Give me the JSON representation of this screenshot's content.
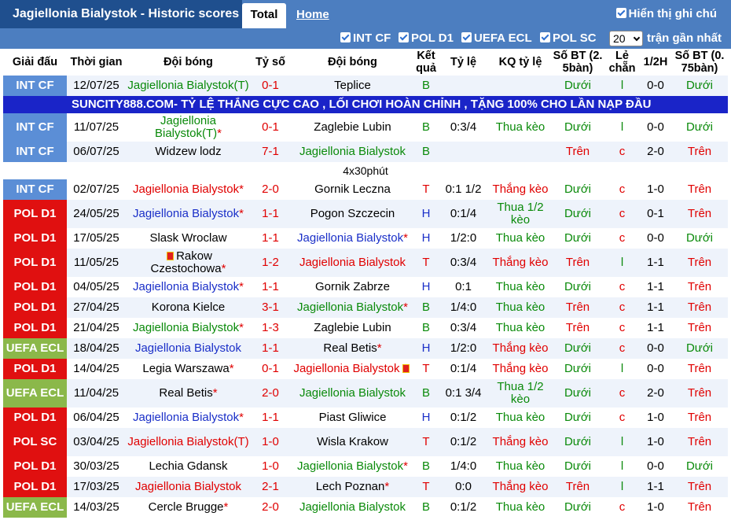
{
  "header": {
    "title": "Jagiellonia Bialystok - Historic scores",
    "tab_total": "Total",
    "tab_home": "Home",
    "vn_label": "Hiển thị ghi chú"
  },
  "filters": {
    "items": [
      "INT CF",
      "POL D1",
      "UEFA ECL",
      "POL SC"
    ],
    "count_value": "20",
    "recent_label": "trận gần nhất"
  },
  "columns": [
    "Giải đấu",
    "Thời gian",
    "Đội bóng",
    "Tỷ số",
    "Đội bóng",
    "Kết quả",
    "Tỷ lệ",
    "KQ tỷ lệ",
    "Số BT (2. 5bàn)",
    "Lẻ chẵn",
    "1/2H",
    "Số BT (0. 75bàn)"
  ],
  "ad_text": "SUNCITY888.COM- TỶ LỆ THẮNG CỰC CAO , LỐI CHƠI HOÀN CHỈNH , TẶNG 100% CHO LẦN NẠP ĐẦU",
  "note_text": "4x30phút",
  "colors": {
    "int_cf": "#5b8ed6",
    "pol": "#e01010",
    "ecl": "#8bb84a",
    "ad": "#1a24c8",
    "bar": "#4c7ec0"
  },
  "rows": [
    {
      "comp": "INT CF",
      "date": "12/07/25",
      "home": "Jagiellonia Bialystok(T)",
      "home_color": "green",
      "home_star": "",
      "score": "0-1",
      "away": "Teplice",
      "away_color": "black",
      "away_star": "",
      "res": "B",
      "odds": "",
      "oddres": "",
      "ou": "Dưới",
      "oe": "l",
      "ht": "0-0",
      "ou2": "Dưới"
    },
    {
      "comp": "INT CF",
      "date": "11/07/25",
      "home": "Jagiellonia Bialystok(T)",
      "home_color": "green",
      "home_star": "*",
      "score": "0-1",
      "away": "Zaglebie Lubin",
      "away_color": "black",
      "away_star": "",
      "res": "B",
      "odds": "0:3/4",
      "oddres": "Thua kèo",
      "ou": "Dưới",
      "oe": "l",
      "ht": "0-0",
      "ou2": "Dưới"
    },
    {
      "comp": "INT CF",
      "date": "06/07/25",
      "home": "Widzew lodz",
      "home_color": "black",
      "home_star": "",
      "score": "7-1",
      "away": "Jagiellonia Bialystok",
      "away_color": "green",
      "away_star": "",
      "res": "B",
      "odds": "",
      "oddres": "",
      "ou": "Trên",
      "oe": "c",
      "ht": "2-0",
      "ou2": "Trên"
    },
    {
      "comp": "INT CF",
      "date": "02/07/25",
      "home": "Jagiellonia Bialystok",
      "home_color": "red",
      "home_star": "*",
      "score": "2-0",
      "away": "Gornik Leczna",
      "away_color": "black",
      "away_star": "",
      "res": "T",
      "odds": "0:1 1/2",
      "oddres": "Thắng kèo",
      "ou": "Dưới",
      "oe": "c",
      "ht": "1-0",
      "ou2": "Trên"
    },
    {
      "comp": "POL D1",
      "date": "24/05/25",
      "home": "Jagiellonia Bialystok",
      "home_color": "blue",
      "home_star": "*",
      "score": "1-1",
      "away": "Pogon Szczecin",
      "away_color": "black",
      "away_star": "",
      "res": "H",
      "odds": "0:1/4",
      "oddres": "Thua 1/2 kèo",
      "ou": "Dưới",
      "oe": "c",
      "ht": "0-1",
      "ou2": "Trên"
    },
    {
      "comp": "POL D1",
      "date": "17/05/25",
      "home": "Slask Wroclaw",
      "home_color": "black",
      "home_star": "",
      "score": "1-1",
      "away": "Jagiellonia Bialystok",
      "away_color": "blue",
      "away_star": "*",
      "res": "H",
      "odds": "1/2:0",
      "oddres": "Thua kèo",
      "ou": "Dưới",
      "oe": "c",
      "ht": "0-0",
      "ou2": "Dưới"
    },
    {
      "comp": "POL D1",
      "date": "11/05/25",
      "home": "Rakow Czestochowa",
      "home_color": "black",
      "home_star": "*",
      "score": "1-2",
      "away": "Jagiellonia Bialystok",
      "away_color": "red",
      "away_star": "",
      "res": "T",
      "odds": "0:3/4",
      "oddres": "Thắng kèo",
      "ou": "Trên",
      "oe": "l",
      "ht": "1-1",
      "ou2": "Trên"
    },
    {
      "comp": "POL D1",
      "date": "04/05/25",
      "home": "Jagiellonia Bialystok",
      "home_color": "blue",
      "home_star": "*",
      "score": "1-1",
      "away": "Gornik Zabrze",
      "away_color": "black",
      "away_star": "",
      "res": "H",
      "odds": "0:1",
      "oddres": "Thua kèo",
      "ou": "Dưới",
      "oe": "c",
      "ht": "1-1",
      "ou2": "Trên"
    },
    {
      "comp": "POL D1",
      "date": "27/04/25",
      "home": "Korona Kielce",
      "home_color": "black",
      "home_star": "",
      "score": "3-1",
      "away": "Jagiellonia Bialystok",
      "away_color": "green",
      "away_star": "*",
      "res": "B",
      "odds": "1/4:0",
      "oddres": "Thua kèo",
      "ou": "Trên",
      "oe": "c",
      "ht": "1-1",
      "ou2": "Trên"
    },
    {
      "comp": "POL D1",
      "date": "21/04/25",
      "home": "Jagiellonia Bialystok",
      "home_color": "green",
      "home_star": "*",
      "score": "1-3",
      "away": "Zaglebie Lubin",
      "away_color": "black",
      "away_star": "",
      "res": "B",
      "odds": "0:3/4",
      "oddres": "Thua kèo",
      "ou": "Trên",
      "oe": "c",
      "ht": "1-1",
      "ou2": "Trên"
    },
    {
      "comp": "UEFA ECL",
      "date": "18/04/25",
      "home": "Jagiellonia Bialystok",
      "home_color": "blue",
      "home_star": "",
      "score": "1-1",
      "away": "Real Betis",
      "away_color": "black",
      "away_star": "*",
      "res": "H",
      "odds": "1/2:0",
      "oddres": "Thắng kèo",
      "ou": "Dưới",
      "oe": "c",
      "ht": "0-0",
      "ou2": "Dưới"
    },
    {
      "comp": "POL D1",
      "date": "14/04/25",
      "home": "Legia Warszawa",
      "home_color": "black",
      "home_star": "*",
      "score": "0-1",
      "away": "Jagiellonia Bialystok",
      "away_color": "red",
      "away_star": "",
      "res": "T",
      "odds": "0:1/4",
      "oddres": "Thắng kèo",
      "ou": "Dưới",
      "oe": "l",
      "ht": "0-0",
      "ou2": "Trên"
    },
    {
      "comp": "UEFA ECL",
      "date": "11/04/25",
      "home": "Real Betis",
      "home_color": "black",
      "home_star": "*",
      "score": "2-0",
      "away": "Jagiellonia Bialystok",
      "away_color": "green",
      "away_star": "",
      "res": "B",
      "odds": "0:1 3/4",
      "oddres": "Thua 1/2 kèo",
      "ou": "Dưới",
      "oe": "c",
      "ht": "2-0",
      "ou2": "Trên"
    },
    {
      "comp": "POL D1",
      "date": "06/04/25",
      "home": "Jagiellonia Bialystok",
      "home_color": "blue",
      "home_star": "*",
      "score": "1-1",
      "away": "Piast Gliwice",
      "away_color": "black",
      "away_star": "",
      "res": "H",
      "odds": "0:1/2",
      "oddres": "Thua kèo",
      "ou": "Dưới",
      "oe": "c",
      "ht": "1-0",
      "ou2": "Trên"
    },
    {
      "comp": "POL SC",
      "date": "03/04/25",
      "home": "Jagiellonia Bialystok(T)",
      "home_color": "red",
      "home_star": "",
      "score": "1-0",
      "away": "Wisla Krakow",
      "away_color": "black",
      "away_star": "",
      "res": "T",
      "odds": "0:1/2",
      "oddres": "Thắng kèo",
      "ou": "Dưới",
      "oe": "l",
      "ht": "1-0",
      "ou2": "Trên"
    },
    {
      "comp": "POL D1",
      "date": "30/03/25",
      "home": "Lechia Gdansk",
      "home_color": "black",
      "home_star": "",
      "score": "1-0",
      "away": "Jagiellonia Bialystok",
      "away_color": "green",
      "away_star": "*",
      "res": "B",
      "odds": "1/4:0",
      "oddres": "Thua kèo",
      "ou": "Dưới",
      "oe": "l",
      "ht": "0-0",
      "ou2": "Dưới"
    },
    {
      "comp": "POL D1",
      "date": "17/03/25",
      "home": "Jagiellonia Bialystok",
      "home_color": "red",
      "home_star": "",
      "score": "2-1",
      "away": "Lech Poznan",
      "away_color": "black",
      "away_star": "*",
      "res": "T",
      "odds": "0:0",
      "oddres": "Thắng kèo",
      "ou": "Trên",
      "oe": "l",
      "ht": "1-1",
      "ou2": "Trên"
    },
    {
      "comp": "UEFA ECL",
      "date": "14/03/25",
      "home": "Cercle Brugge",
      "home_color": "black",
      "home_star": "*",
      "score": "2-0",
      "away": "Jagiellonia Bialystok",
      "away_color": "green",
      "away_star": "",
      "res": "B",
      "odds": "0:1/2",
      "oddres": "Thua kèo",
      "ou": "Dưới",
      "oe": "c",
      "ht": "1-0",
      "ou2": "Trên"
    }
  ]
}
